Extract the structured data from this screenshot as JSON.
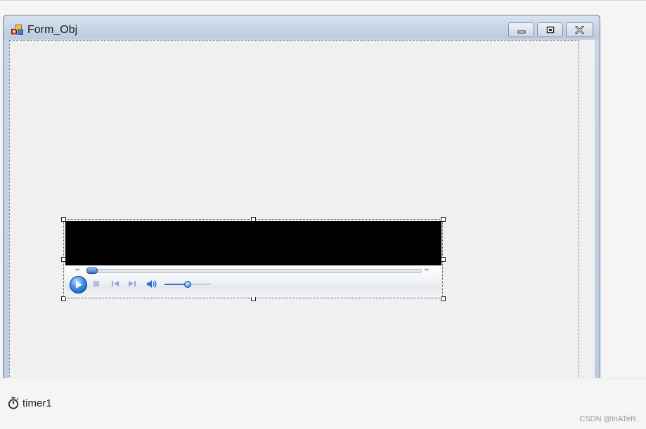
{
  "form": {
    "title": "Form_Obj",
    "icon": "form-app-icon",
    "caption_buttons": [
      "minimize-icon",
      "maximize-icon",
      "close-icon"
    ]
  },
  "media_player": {
    "control": "windows-media-player",
    "video_color": "#000000",
    "accent_color": "#2f73cf",
    "seek_progress": 0,
    "volume_level": 0.5,
    "controls": [
      "play-icon",
      "stop-icon",
      "previous-icon",
      "next-icon",
      "volume-icon"
    ]
  },
  "component_tray": {
    "items": [
      {
        "label": "timer1",
        "icon": "stopwatch-icon"
      }
    ]
  },
  "watermark": "CSDN @InATeR"
}
